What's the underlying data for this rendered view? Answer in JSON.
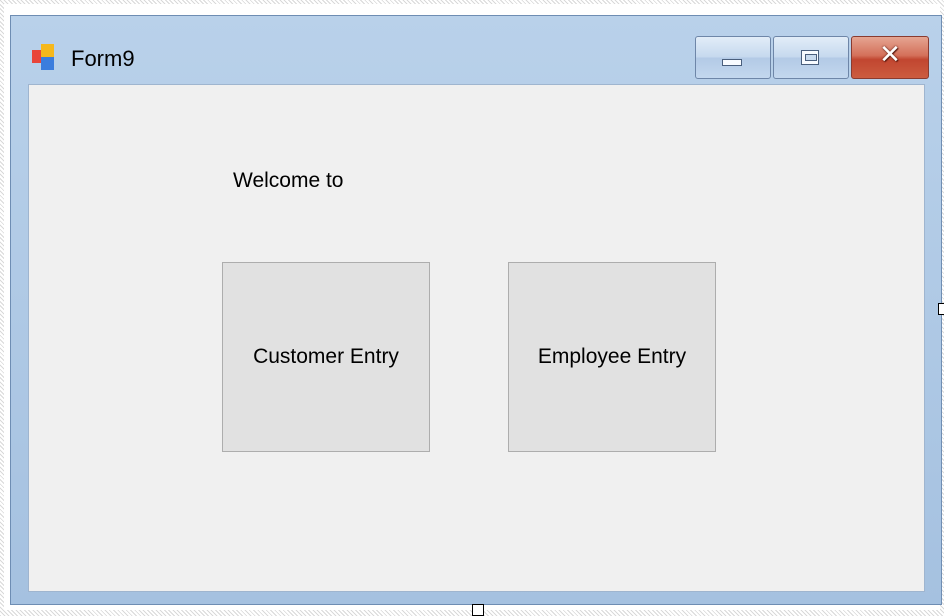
{
  "window": {
    "title": "Form9",
    "icon": "windows-form-icon",
    "controls": {
      "minimize_icon": "minimize-icon",
      "maximize_icon": "maximize-icon",
      "close_glyph": "✕"
    }
  },
  "form": {
    "welcome_label": "Welcome to",
    "buttons": {
      "customer_entry": "Customer Entry",
      "employee_entry": "Employee Entry"
    }
  },
  "colors": {
    "titlebar": "#b9d1ea",
    "client_background": "#f0f0f0",
    "button_face": "#e1e1e1",
    "close_button": "#c14630"
  }
}
